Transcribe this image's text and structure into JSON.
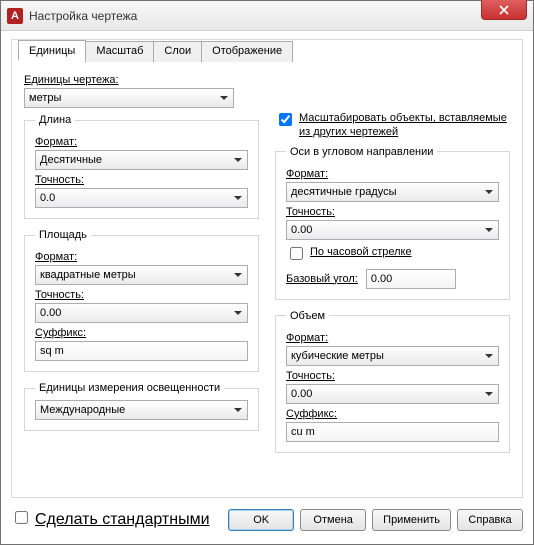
{
  "window": {
    "title": "Настройка чертежа"
  },
  "tabs": {
    "units": "Единицы",
    "scale": "Масштаб",
    "layers": "Слои",
    "display": "Отображение"
  },
  "units": {
    "drawing_units_label": "Единицы чертежа:",
    "drawing_units_value": "метры",
    "length": {
      "legend": "Длина",
      "format_label": "Формат:",
      "format_value": "Десятичные",
      "precision_label": "Точность:",
      "precision_value": "0.0"
    },
    "area": {
      "legend": "Площадь",
      "format_label": "Формат:",
      "format_value": "квадратные метры",
      "precision_label": "Точность:",
      "precision_value": "0.00",
      "suffix_label": "Суффикс:",
      "suffix_value": "sq m"
    },
    "lighting": {
      "legend": "Единицы измерения освещенности",
      "value": "Международные"
    },
    "scale_objects_label": "Масштабировать объекты, вставляемые из других чертежей",
    "scale_objects_checked": true,
    "angle": {
      "legend": "Оси в угловом направлении",
      "format_label": "Формат:",
      "format_value": "десятичные градусы",
      "precision_label": "Точность:",
      "precision_value": "0.00",
      "clockwise_label": "По часовой стрелке",
      "clockwise_checked": false,
      "base_angle_label": "Базовый угол:",
      "base_angle_value": "0.00"
    },
    "volume": {
      "legend": "Объем",
      "format_label": "Формат:",
      "format_value": "кубические метры",
      "precision_label": "Точность:",
      "precision_value": "0.00",
      "suffix_label": "Суффикс:",
      "suffix_value": "cu m"
    }
  },
  "footer": {
    "make_default_label": "Сделать стандартными",
    "make_default_checked": false,
    "ok": "OK",
    "cancel": "Отмена",
    "apply": "Применить",
    "help": "Справка"
  }
}
